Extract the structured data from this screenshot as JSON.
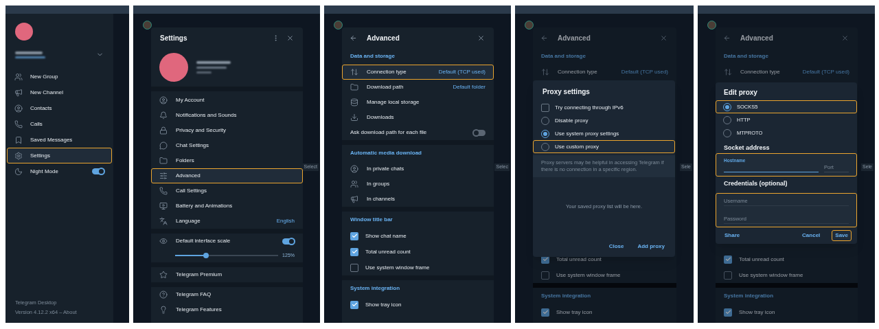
{
  "panels": [
    {
      "kind": "side_menu",
      "items": [
        {
          "kind": "link",
          "label": "New Group",
          "highlighted": false
        },
        {
          "kind": "link",
          "label": "New Channel",
          "highlighted": false
        },
        {
          "kind": "link",
          "label": "Contacts",
          "highlighted": false
        },
        {
          "kind": "link",
          "label": "Calls",
          "highlighted": false
        },
        {
          "kind": "link",
          "label": "Saved Messages",
          "highlighted": false
        },
        {
          "kind": "link",
          "label": "Settings",
          "highlighted": true
        },
        {
          "kind": "toggle",
          "label": "Night Mode",
          "on": true,
          "highlighted": false
        }
      ],
      "footer": {
        "app_name": "Telegram Desktop",
        "version": "Version 4.12.2 x64 – About"
      }
    },
    {
      "kind": "settings",
      "title": "Settings",
      "menu": [
        {
          "label": "My Account",
          "highlighted": false
        },
        {
          "label": "Notifications and Sounds",
          "highlighted": false
        },
        {
          "label": "Privacy and Security",
          "highlighted": false
        },
        {
          "label": "Chat Settings",
          "highlighted": false
        },
        {
          "label": "Folders",
          "highlighted": false
        },
        {
          "label": "Advanced",
          "highlighted": true
        },
        {
          "label": "Call Settings",
          "highlighted": false
        },
        {
          "label": "Battery and Animations",
          "highlighted": false
        },
        {
          "label": "Language",
          "value": "English",
          "highlighted": false
        }
      ],
      "scale": {
        "label": "Default interface scale",
        "on": true,
        "level": 0.3,
        "reading": "125%"
      },
      "premium": "Telegram Premium",
      "help": [
        "Telegram FAQ",
        "Telegram Features"
      ],
      "side_hint": "Select"
    },
    {
      "kind": "advanced",
      "title": "Advanced",
      "sections": [
        {
          "title": "Data and storage",
          "rows": [
            {
              "kind": "link",
              "label": "Connection type",
              "value": "Default (TCP used)",
              "highlighted": true
            },
            {
              "kind": "link",
              "label": "Download path",
              "value": "Default folder",
              "highlighted": false
            },
            {
              "kind": "link",
              "label": "Manage local storage",
              "highlighted": false
            },
            {
              "kind": "link",
              "label": "Downloads",
              "highlighted": false
            },
            {
              "kind": "toggle",
              "label": "Ask download path for each file",
              "on": false,
              "highlighted": false
            }
          ]
        },
        {
          "title": "Automatic media download",
          "rows": [
            {
              "kind": "link",
              "label": "In private chats",
              "highlighted": false
            },
            {
              "kind": "link",
              "label": "In groups",
              "highlighted": false
            },
            {
              "kind": "link",
              "label": "In channels",
              "highlighted": false
            }
          ]
        },
        {
          "title": "Window title bar",
          "rows": [
            {
              "kind": "checkbox",
              "label": "Show chat name",
              "checked": true,
              "highlighted": false
            },
            {
              "kind": "checkbox",
              "label": "Total unread count",
              "checked": true,
              "highlighted": false
            },
            {
              "kind": "checkbox",
              "label": "Use system window frame",
              "checked": false,
              "highlighted": false
            }
          ]
        },
        {
          "title": "System integration",
          "rows": [
            {
              "kind": "checkbox",
              "label": "Show tray icon",
              "checked": true,
              "highlighted": false
            }
          ]
        }
      ],
      "side_hint": "Selec"
    },
    {
      "kind": "advanced",
      "title": "Advanced",
      "sections": [
        {
          "title": "Data and storage",
          "rows": [
            {
              "kind": "link",
              "label": "Connection type",
              "value": "Default (TCP used)",
              "highlighted": false
            }
          ]
        },
        {
          "rows": [
            {
              "kind": "checkbox",
              "label": "Total unread count",
              "checked": true,
              "highlighted": false
            },
            {
              "kind": "checkbox",
              "label": "Use system window frame",
              "checked": false,
              "highlighted": false
            }
          ]
        },
        {
          "title": "System integration",
          "rows": [
            {
              "kind": "checkbox",
              "label": "Show tray icon",
              "checked": true,
              "highlighted": false
            }
          ]
        }
      ],
      "side_hint": "Sele",
      "dialog": {
        "kind": "proxy_settings",
        "title": "Proxy settings",
        "options": [
          {
            "kind": "checkbox",
            "label": "Try connecting through IPv6",
            "checked": false,
            "highlighted": false
          },
          {
            "kind": "radio",
            "label": "Disable proxy",
            "selected": false,
            "highlighted": false
          },
          {
            "kind": "radio",
            "label": "Use system proxy settings",
            "selected": true,
            "highlighted": false
          },
          {
            "kind": "radio",
            "label": "Use custom proxy",
            "selected": false,
            "highlighted": true
          }
        ],
        "note": "Proxy servers may be helpful in accessing Telegram if there is no connection in a specific region.",
        "empty_text": "Your saved proxy list will be here.",
        "buttons": [
          {
            "label": "Close",
            "highlighted": false
          },
          {
            "label": "Add proxy",
            "highlighted": false
          }
        ]
      }
    },
    {
      "kind": "advanced",
      "title": "Advanced",
      "sections": [
        {
          "title": "Data and storage",
          "rows": [
            {
              "kind": "link",
              "label": "Connection type",
              "value": "Default (TCP used)",
              "highlighted": false
            }
          ]
        },
        {
          "rows": [
            {
              "kind": "checkbox",
              "label": "Total unread count",
              "checked": true,
              "highlighted": false
            },
            {
              "kind": "checkbox",
              "label": "Use system window frame",
              "checked": false,
              "highlighted": false
            }
          ]
        },
        {
          "title": "System integration",
          "rows": [
            {
              "kind": "checkbox",
              "label": "Show tray icon",
              "checked": true,
              "highlighted": false
            }
          ]
        }
      ],
      "side_hint": "Sele",
      "dialog": {
        "kind": "edit_proxy",
        "title": "Edit proxy",
        "types": [
          {
            "label": "SOCKS5",
            "selected": true,
            "highlighted": true
          },
          {
            "label": "HTTP",
            "selected": false,
            "highlighted": false
          },
          {
            "label": "MTPROTO",
            "selected": false,
            "highlighted": false
          }
        ],
        "socket": {
          "title": "Socket address",
          "highlighted": true,
          "host_label": "Hostname",
          "port_placeholder": "Port"
        },
        "credentials": {
          "title": "Credentials (optional)",
          "highlighted": true,
          "fields": [
            {
              "placeholder": "Username"
            },
            {
              "placeholder": "Password"
            }
          ]
        },
        "share": {
          "label": "Share",
          "highlighted": false
        },
        "buttons": [
          {
            "label": "Cancel",
            "highlighted": false
          },
          {
            "label": "Save",
            "highlighted": true
          }
        ]
      }
    }
  ]
}
